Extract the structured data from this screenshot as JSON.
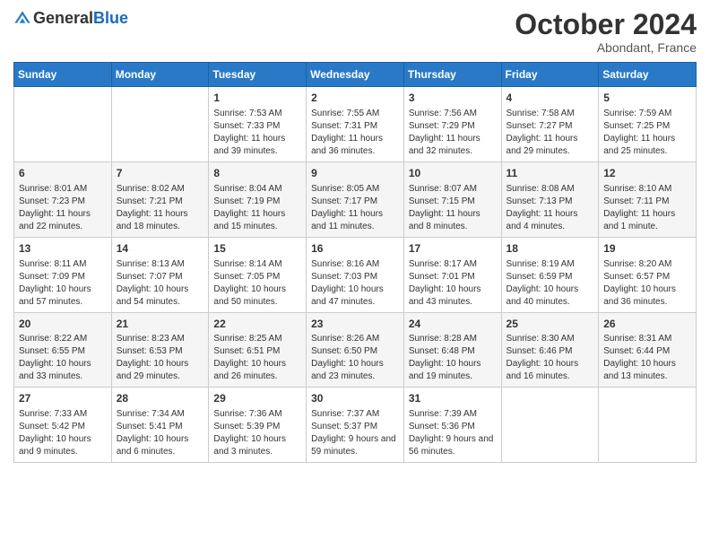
{
  "header": {
    "logo_general": "General",
    "logo_blue": "Blue",
    "month": "October 2024",
    "location": "Abondant, France"
  },
  "weekdays": [
    "Sunday",
    "Monday",
    "Tuesday",
    "Wednesday",
    "Thursday",
    "Friday",
    "Saturday"
  ],
  "weeks": [
    [
      {
        "day": "",
        "info": ""
      },
      {
        "day": "",
        "info": ""
      },
      {
        "day": "1",
        "info": "Sunrise: 7:53 AM\nSunset: 7:33 PM\nDaylight: 11 hours and 39 minutes."
      },
      {
        "day": "2",
        "info": "Sunrise: 7:55 AM\nSunset: 7:31 PM\nDaylight: 11 hours and 36 minutes."
      },
      {
        "day": "3",
        "info": "Sunrise: 7:56 AM\nSunset: 7:29 PM\nDaylight: 11 hours and 32 minutes."
      },
      {
        "day": "4",
        "info": "Sunrise: 7:58 AM\nSunset: 7:27 PM\nDaylight: 11 hours and 29 minutes."
      },
      {
        "day": "5",
        "info": "Sunrise: 7:59 AM\nSunset: 7:25 PM\nDaylight: 11 hours and 25 minutes."
      }
    ],
    [
      {
        "day": "6",
        "info": "Sunrise: 8:01 AM\nSunset: 7:23 PM\nDaylight: 11 hours and 22 minutes."
      },
      {
        "day": "7",
        "info": "Sunrise: 8:02 AM\nSunset: 7:21 PM\nDaylight: 11 hours and 18 minutes."
      },
      {
        "day": "8",
        "info": "Sunrise: 8:04 AM\nSunset: 7:19 PM\nDaylight: 11 hours and 15 minutes."
      },
      {
        "day": "9",
        "info": "Sunrise: 8:05 AM\nSunset: 7:17 PM\nDaylight: 11 hours and 11 minutes."
      },
      {
        "day": "10",
        "info": "Sunrise: 8:07 AM\nSunset: 7:15 PM\nDaylight: 11 hours and 8 minutes."
      },
      {
        "day": "11",
        "info": "Sunrise: 8:08 AM\nSunset: 7:13 PM\nDaylight: 11 hours and 4 minutes."
      },
      {
        "day": "12",
        "info": "Sunrise: 8:10 AM\nSunset: 7:11 PM\nDaylight: 11 hours and 1 minute."
      }
    ],
    [
      {
        "day": "13",
        "info": "Sunrise: 8:11 AM\nSunset: 7:09 PM\nDaylight: 10 hours and 57 minutes."
      },
      {
        "day": "14",
        "info": "Sunrise: 8:13 AM\nSunset: 7:07 PM\nDaylight: 10 hours and 54 minutes."
      },
      {
        "day": "15",
        "info": "Sunrise: 8:14 AM\nSunset: 7:05 PM\nDaylight: 10 hours and 50 minutes."
      },
      {
        "day": "16",
        "info": "Sunrise: 8:16 AM\nSunset: 7:03 PM\nDaylight: 10 hours and 47 minutes."
      },
      {
        "day": "17",
        "info": "Sunrise: 8:17 AM\nSunset: 7:01 PM\nDaylight: 10 hours and 43 minutes."
      },
      {
        "day": "18",
        "info": "Sunrise: 8:19 AM\nSunset: 6:59 PM\nDaylight: 10 hours and 40 minutes."
      },
      {
        "day": "19",
        "info": "Sunrise: 8:20 AM\nSunset: 6:57 PM\nDaylight: 10 hours and 36 minutes."
      }
    ],
    [
      {
        "day": "20",
        "info": "Sunrise: 8:22 AM\nSunset: 6:55 PM\nDaylight: 10 hours and 33 minutes."
      },
      {
        "day": "21",
        "info": "Sunrise: 8:23 AM\nSunset: 6:53 PM\nDaylight: 10 hours and 29 minutes."
      },
      {
        "day": "22",
        "info": "Sunrise: 8:25 AM\nSunset: 6:51 PM\nDaylight: 10 hours and 26 minutes."
      },
      {
        "day": "23",
        "info": "Sunrise: 8:26 AM\nSunset: 6:50 PM\nDaylight: 10 hours and 23 minutes."
      },
      {
        "day": "24",
        "info": "Sunrise: 8:28 AM\nSunset: 6:48 PM\nDaylight: 10 hours and 19 minutes."
      },
      {
        "day": "25",
        "info": "Sunrise: 8:30 AM\nSunset: 6:46 PM\nDaylight: 10 hours and 16 minutes."
      },
      {
        "day": "26",
        "info": "Sunrise: 8:31 AM\nSunset: 6:44 PM\nDaylight: 10 hours and 13 minutes."
      }
    ],
    [
      {
        "day": "27",
        "info": "Sunrise: 7:33 AM\nSunset: 5:42 PM\nDaylight: 10 hours and 9 minutes."
      },
      {
        "day": "28",
        "info": "Sunrise: 7:34 AM\nSunset: 5:41 PM\nDaylight: 10 hours and 6 minutes."
      },
      {
        "day": "29",
        "info": "Sunrise: 7:36 AM\nSunset: 5:39 PM\nDaylight: 10 hours and 3 minutes."
      },
      {
        "day": "30",
        "info": "Sunrise: 7:37 AM\nSunset: 5:37 PM\nDaylight: 9 hours and 59 minutes."
      },
      {
        "day": "31",
        "info": "Sunrise: 7:39 AM\nSunset: 5:36 PM\nDaylight: 9 hours and 56 minutes."
      },
      {
        "day": "",
        "info": ""
      },
      {
        "day": "",
        "info": ""
      }
    ]
  ]
}
